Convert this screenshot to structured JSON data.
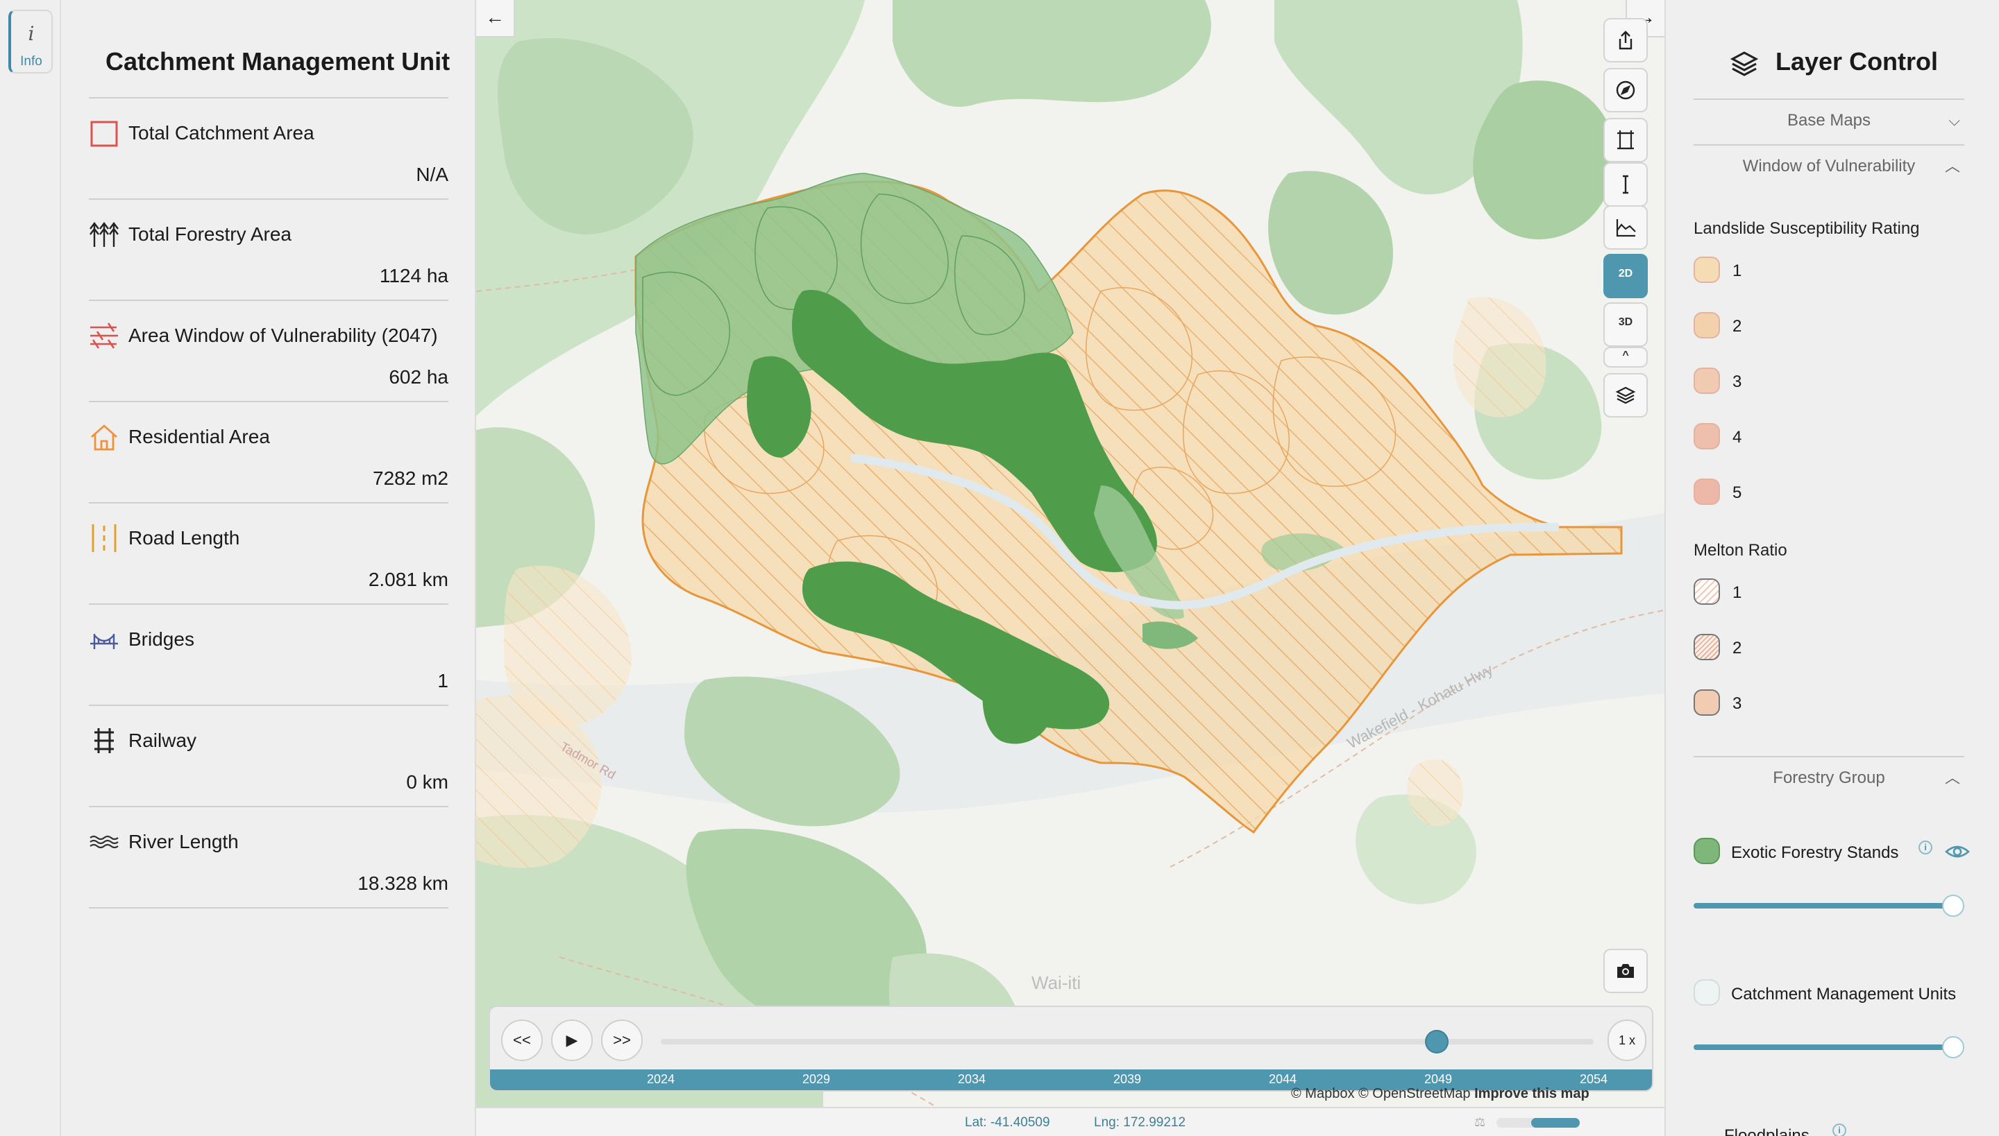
{
  "rail": {
    "tab_glyph": "i",
    "tab_label": "Info"
  },
  "left_panel": {
    "title": "Catchment Management Unit",
    "stats": [
      {
        "icon": "square-outline-icon",
        "label": "Total Catchment Area",
        "value": "N/A"
      },
      {
        "icon": "forest-icon",
        "label": "Total Forestry Area",
        "value": "1124 ha"
      },
      {
        "icon": "vulnerability-icon",
        "label": "Area Window of Vulnerability (2047)",
        "value": "602 ha"
      },
      {
        "icon": "house-icon",
        "label": "Residential Area",
        "value": "7282 m2"
      },
      {
        "icon": "road-icon",
        "label": "Road Length",
        "value": "2.081 km"
      },
      {
        "icon": "bridge-icon",
        "label": "Bridges",
        "value": "1"
      },
      {
        "icon": "railway-icon",
        "label": "Railway",
        "value": "0 km"
      },
      {
        "icon": "river-icon",
        "label": "River Length",
        "value": "18.328 km"
      }
    ]
  },
  "map": {
    "collapse_left_glyph": "←",
    "collapse_right_glyph": "→",
    "controls": [
      {
        "name": "share-icon"
      },
      {
        "name": "compass-icon"
      },
      {
        "name": "area-measure-icon"
      },
      {
        "name": "distance-measure-icon"
      },
      {
        "name": "elevation-profile-icon"
      },
      {
        "name": "view-2d-button",
        "text": "2D",
        "active": true
      },
      {
        "name": "view-3d-button",
        "text": "3D"
      },
      {
        "name": "chevron-up-icon",
        "text": "^"
      },
      {
        "name": "layers-icon"
      }
    ],
    "timeline": {
      "rewind": "<<",
      "play": "▶",
      "forward": ">>",
      "speed": "1 x",
      "years": [
        "2024",
        "2029",
        "2034",
        "2039",
        "2044",
        "2049",
        "2054"
      ],
      "current_fraction": 0.832
    },
    "road_label": "Wakefield - Kohatu Hwy",
    "road_label_2": "Tadmor Rd",
    "town_label": "Wai-iti",
    "attribution": "© Mapbox © OpenStreetMap",
    "attribution_link": "Improve this map",
    "lat": "Lat: -41.40509",
    "lng": "Lng: 172.99212"
  },
  "right_panel": {
    "title": "Layer Control",
    "base_maps": "Base Maps",
    "wov": "Window of Vulnerability",
    "landslide_title": "Landslide Susceptibility Rating",
    "landslide_items": [
      "1",
      "2",
      "3",
      "4",
      "5"
    ],
    "landslide_colors": [
      "#f6dcb4",
      "#f3d1ad",
      "#f1cab2",
      "#efbfae",
      "#eeb8a8"
    ],
    "melton_title": "Melton Ratio",
    "melton_items": [
      "1",
      "2",
      "3"
    ],
    "forestry_group": "Forestry Group",
    "exotic": "Exotic Forestry Stands",
    "cmu": "Catchment Management Units",
    "floodplains": "Floodplains",
    "info_glyph": "i"
  }
}
